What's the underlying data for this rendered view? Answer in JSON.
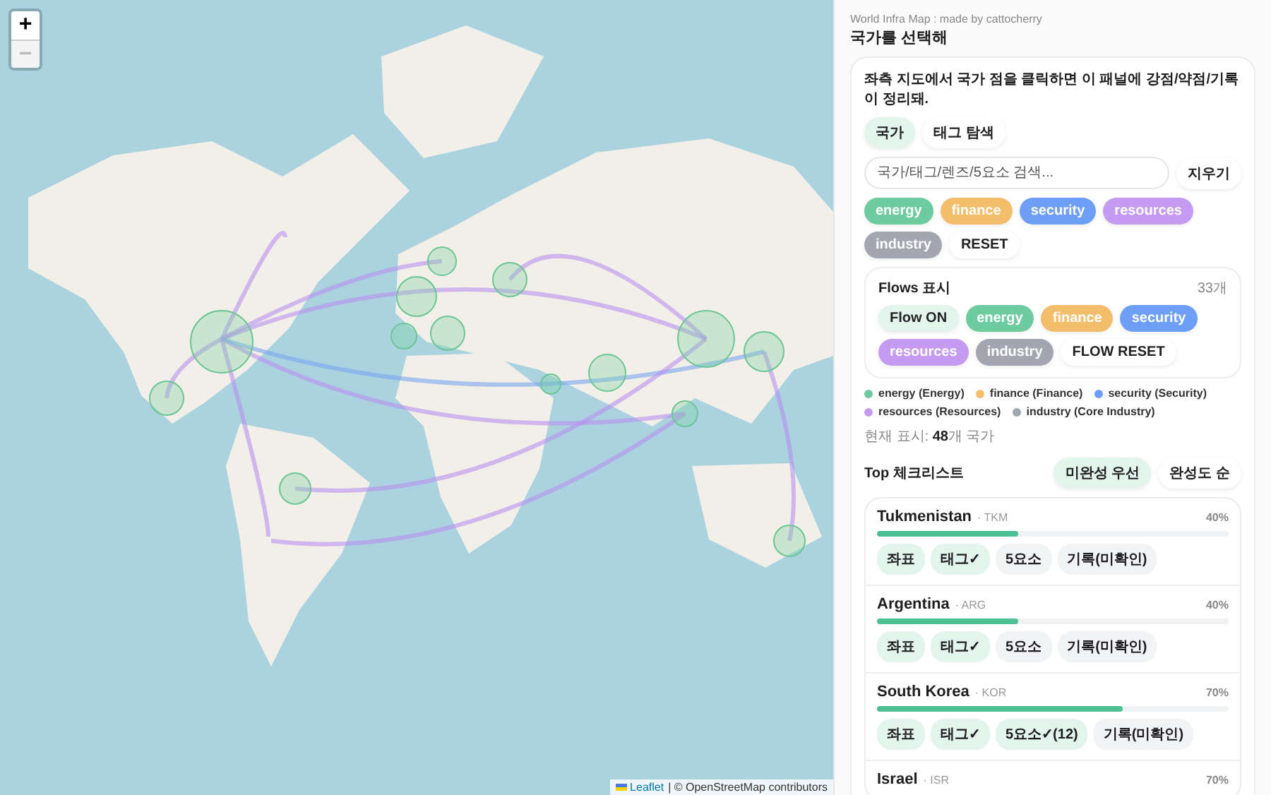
{
  "map": {
    "zoom_in": {
      "label": "+",
      "disabled": false
    },
    "zoom_out": {
      "label": "−",
      "disabled": true
    },
    "attribution": {
      "link": "Leaflet",
      "text": "| © OpenStreetMap contributors"
    }
  },
  "panel": {
    "subtitle": "World Infra Map : made by cattocherry",
    "title": "국가를 선택해",
    "intro": "좌측 지도에서 국가 점을 클릭하면 이 패널에 강점/약점/기록이 정리돼.",
    "modes": [
      {
        "label": "국가",
        "selected": true
      },
      {
        "label": "태그 탐색",
        "selected": false
      }
    ],
    "search": {
      "placeholder": "국가/태그/렌즈/5요소 검색..."
    },
    "clear_button": "지우기",
    "filters": [
      {
        "label": "energy",
        "color": "#6dcb9f"
      },
      {
        "label": "finance",
        "color": "#f4bd6b"
      },
      {
        "label": "security",
        "color": "#6e9ff6"
      },
      {
        "label": "resources",
        "color": "#c59bf2"
      },
      {
        "label": "industry",
        "color": "#a3a6b1"
      }
    ],
    "reset_button": "RESET"
  },
  "flows": {
    "title": "Flows 표시",
    "count": "33개",
    "toggle": {
      "label": "Flow ON",
      "on": true
    },
    "filters": [
      {
        "label": "energy",
        "color": "#6dcb9f"
      },
      {
        "label": "finance",
        "color": "#f4bd6b"
      },
      {
        "label": "security",
        "color": "#6e9ff6"
      },
      {
        "label": "resources",
        "color": "#c59bf2"
      },
      {
        "label": "industry",
        "color": "#a3a6b1"
      }
    ],
    "reset_button": "FLOW RESET"
  },
  "legend": [
    {
      "label": "energy (Energy)",
      "color": "#6dcb9f"
    },
    {
      "label": "finance (Finance)",
      "color": "#f4bd6b"
    },
    {
      "label": "security (Security)",
      "color": "#6e9ff6"
    },
    {
      "label": "resources (Resources)",
      "color": "#c59bf2"
    },
    {
      "label": "industry (Core Industry)",
      "color": "#a3a6b1"
    }
  ],
  "shown": "현재 표시: **48**개 국가",
  "checklist": {
    "title": "Top 체크리스트",
    "sorts": [
      {
        "label": "미완성 우선",
        "selected": true
      },
      {
        "label": "완성도 순",
        "selected": false
      }
    ],
    "items": [
      {
        "name": "Tukmenistan",
        "code": "· TKM",
        "percent": "40%",
        "level": 0.4,
        "tags": [
          {
            "label": "좌표",
            "done": true
          },
          {
            "label": "태그✓",
            "done": true
          },
          {
            "label": "5요소",
            "done": false
          },
          {
            "label": "기록(미확인)",
            "done": false
          }
        ]
      },
      {
        "name": "Argentina",
        "code": "· ARG",
        "percent": "40%",
        "level": 0.4,
        "tags": [
          {
            "label": "좌표",
            "done": true
          },
          {
            "label": "태그✓",
            "done": true
          },
          {
            "label": "5요소",
            "done": false
          },
          {
            "label": "기록(미확인)",
            "done": false
          }
        ]
      },
      {
        "name": "South Korea",
        "code": "· KOR",
        "percent": "70%",
        "level": 0.7,
        "tags": [
          {
            "label": "좌표",
            "done": true
          },
          {
            "label": "태그✓",
            "done": true
          },
          {
            "label": "5요소✓(12)",
            "done": true
          },
          {
            "label": "기록(미확인)",
            "done": false
          }
        ]
      },
      {
        "name": "Israel",
        "code": "· ISR",
        "percent": "70%"
      }
    ]
  }
}
